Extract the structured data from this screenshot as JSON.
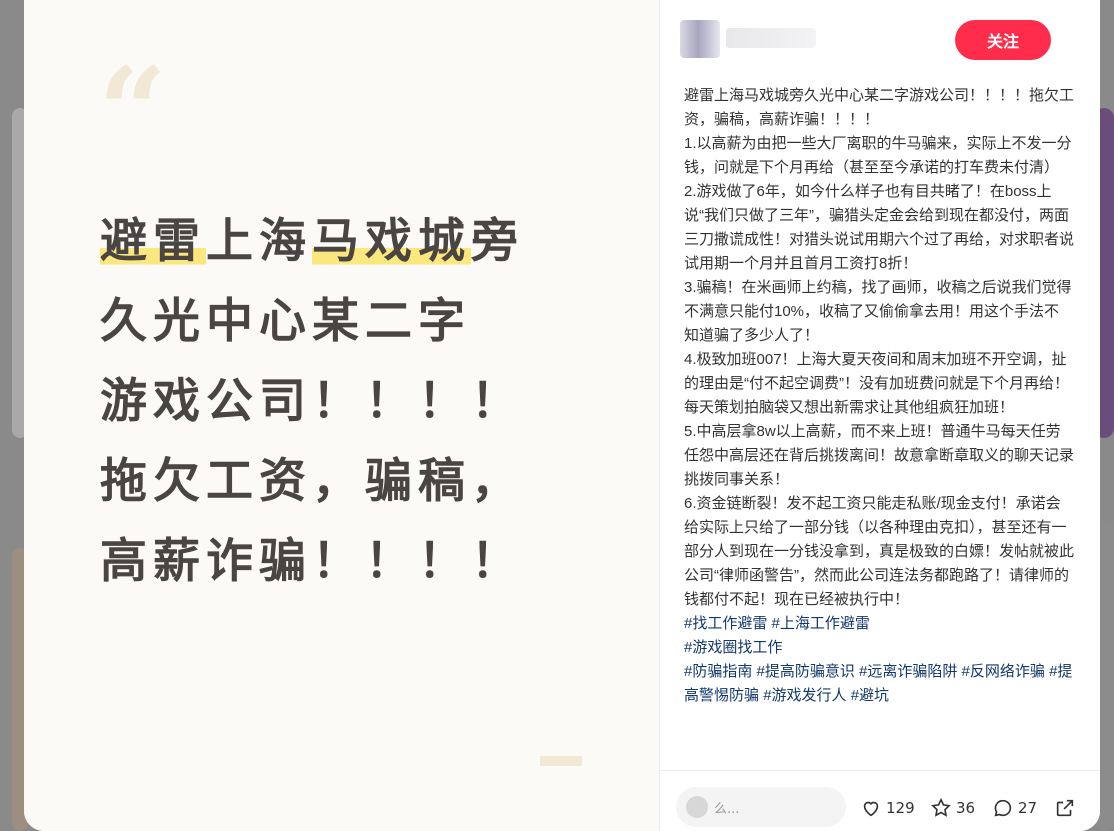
{
  "poster": {
    "quote_glyph": "“",
    "lines": [
      {
        "parts": [
          {
            "text": "避雷",
            "hl": true
          },
          {
            "text": "上海",
            "hl": false
          },
          {
            "text": "马戏城",
            "hl": true
          },
          {
            "text": "旁",
            "hl": false
          }
        ]
      },
      {
        "parts": [
          {
            "text": "久光中心某二字",
            "hl": false
          }
        ]
      },
      {
        "parts": [
          {
            "text": "游戏公司！！！！",
            "hl": false
          }
        ]
      },
      {
        "parts": [
          {
            "text": "拖欠工资，骗稿，",
            "hl": false
          }
        ]
      },
      {
        "parts": [
          {
            "text": "高薪诈骗！！！！",
            "hl": false
          }
        ]
      }
    ]
  },
  "author": {
    "follow_label": "关注"
  },
  "note": {
    "paragraphs": [
      "避雷上海马戏城旁久光中心某二字游戏公司！！！！拖欠工资，骗稿，高薪诈骗！！！！",
      "1.以高薪为由把一些大厂离职的牛马骗来，实际上不发一分钱，问就是下个月再给（甚至至今承诺的打车费未付清）",
      "2.游戏做了6年，如今什么样子也有目共睹了！在boss上说“我们只做了三年”，骗猎头定金会给到现在都没付，两面三刀撒谎成性！对猎头说试用期六个过了再给，对求职者说试用期一个月并且首月工资打8折！",
      "3.骗稿！在米画师上约稿，找了画师，收稿之后说我们觉得不满意只能付10%，收稿了又偷偷拿去用！用这个手法不知道骗了多少人了！",
      "4.极致加班007！上海大夏天夜间和周末加班不开空调，扯的理由是“付不起空调费”！没有加班费问就是下个月再给！每天策划拍脑袋又想出新需求让其他组疯狂加班！",
      "5.中高层拿8w以上高薪，而不来上班！普通牛马每天任劳任怨中高层还在背后挑拨离间！故意拿断章取义的聊天记录挑拨同事关系！",
      "6.资金链断裂！发不起工资只能走私账/现金支付！承诺会给实际上只给了一部分钱（以各种理由克扣），甚至还有一部分人到现在一分钱没拿到，真是极致的白嫖！发帖就被此公司“律师函警告”，然而此公司连法务都跑路了！请律师的钱都付不起！现在已经被执行中！"
    ],
    "tag_lines": [
      [
        "#找工作避雷",
        "#上海工作避雷"
      ],
      [
        "#游戏圈找工作"
      ],
      [
        "#防骗指南",
        "#提高防骗意识",
        "#远离诈骗陷阱",
        "#反网络诈骗",
        "#提高警惕防骗",
        "#游戏发行人",
        "#避坑"
      ]
    ]
  },
  "footer": {
    "comment_placeholder": "么...",
    "likes": "129",
    "stars": "36",
    "comments": "27"
  },
  "colors": {
    "accent": "#ff2d4b",
    "tag": "#13386c",
    "highlight": "#fae77e"
  }
}
